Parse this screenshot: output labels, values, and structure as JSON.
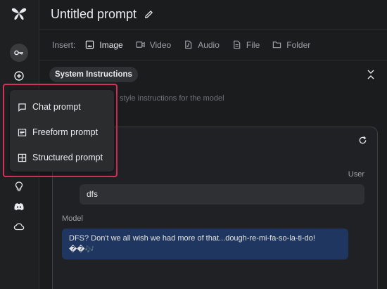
{
  "header": {
    "title": "Untitled prompt"
  },
  "insert_bar": {
    "label": "Insert:",
    "items": [
      {
        "label": "Image",
        "icon": "image-icon"
      },
      {
        "label": "Video",
        "icon": "video-icon"
      },
      {
        "label": "Audio",
        "icon": "audio-icon"
      },
      {
        "label": "File",
        "icon": "file-icon"
      },
      {
        "label": "Folder",
        "icon": "folder-icon"
      }
    ]
  },
  "system_instructions": {
    "label": "System Instructions",
    "placeholder": "style instructions for the model"
  },
  "chat": {
    "user_label": "User",
    "user_message": "dfs",
    "model_label": "Model",
    "model_message": "DFS? Don't we all wish we had more of that...dough-re-mi-fa-so-la-ti-do! ��🎶"
  },
  "new_prompt_menu": {
    "items": [
      {
        "label": "Chat prompt",
        "icon": "chat-bubble-icon"
      },
      {
        "label": "Freeform prompt",
        "icon": "freeform-icon"
      },
      {
        "label": "Structured prompt",
        "icon": "grid-icon"
      }
    ]
  },
  "colors": {
    "background": "#1b1c1d",
    "model_bubble": "#1f3760",
    "highlight_border": "#d6315a"
  }
}
